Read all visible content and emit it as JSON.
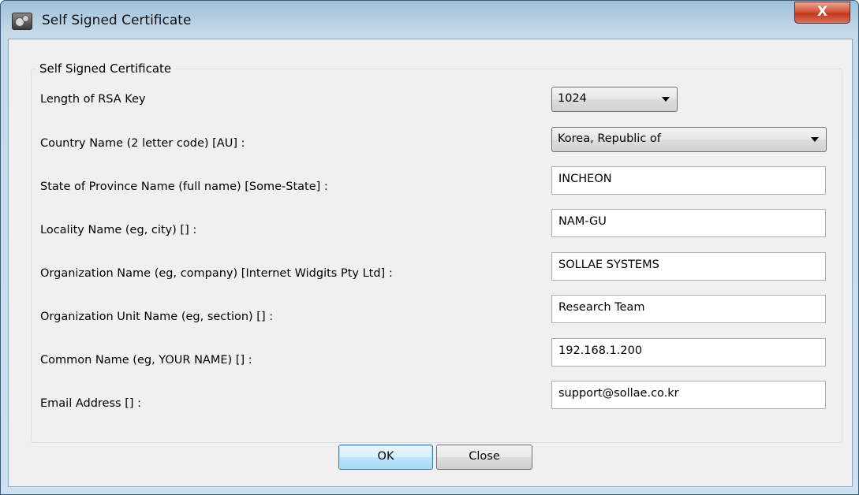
{
  "window": {
    "title": "Self Signed Certificate",
    "close_glyph": "X"
  },
  "group": {
    "legend": "Self Signed Certificate"
  },
  "fields": {
    "rsa_key": {
      "label": "Length of RSA Key",
      "value": "1024"
    },
    "country": {
      "label": "Country Name (2 letter code) [AU] :",
      "value": "Korea, Republic of"
    },
    "state": {
      "label": "State of Province Name (full name) [Some-State] :",
      "value": "INCHEON"
    },
    "locality": {
      "label": "Locality Name (eg, city) [] :",
      "value": "NAM-GU"
    },
    "organization": {
      "label": "Organization Name (eg, company) [Internet Widgits Pty Ltd] :",
      "value": "SOLLAE SYSTEMS"
    },
    "org_unit": {
      "label": "Organization Unit Name (eg, section) [] :",
      "value": "Research Team"
    },
    "common_name": {
      "label": "Common Name (eg, YOUR NAME) [] :",
      "value": "192.168.1.200"
    },
    "email": {
      "label": "Email Address [] :",
      "value": "support@sollae.co.kr"
    }
  },
  "buttons": {
    "ok": "OK",
    "close": "Close"
  },
  "icons": {
    "app": "gears-icon",
    "close": "close-icon",
    "dropdown": "chevron-down-icon"
  },
  "colors": {
    "title_bar": "#b9d1e6",
    "close_button": "#c74a33",
    "ok_button_focus": "#3c7fb1",
    "dialog_background": "#f0f0f0"
  }
}
